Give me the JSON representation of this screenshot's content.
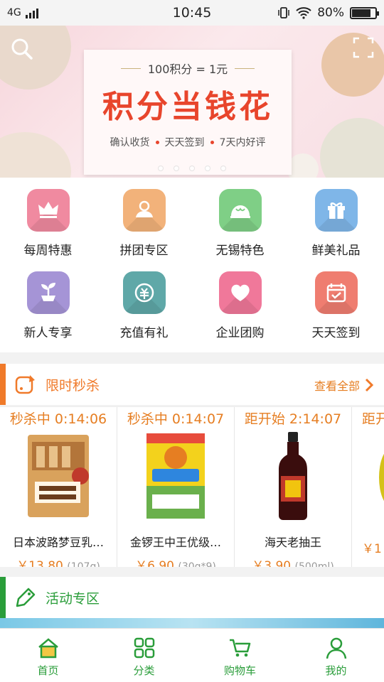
{
  "status_bar": {
    "network": "4G",
    "time": "10:45",
    "battery": "80%",
    "battery_level": 0.8
  },
  "banner": {
    "top_line": "100积分 = 1元",
    "title": "积分当钱花",
    "subs": [
      "确认收货",
      "天天签到",
      "7天内好评"
    ],
    "slides": 5,
    "active_slide": 3
  },
  "categories": [
    {
      "label": "每周特惠",
      "icon": "crown-icon",
      "color": "#f08aa0"
    },
    {
      "label": "拼团专区",
      "icon": "group-icon",
      "color": "#f2b27a"
    },
    {
      "label": "无锡特色",
      "icon": "bun-icon",
      "color": "#7fcf86"
    },
    {
      "label": "鲜美礼品",
      "icon": "gift-icon",
      "color": "#7fb6e8"
    },
    {
      "label": "新人专享",
      "icon": "sprout-icon",
      "color": "#a594d6"
    },
    {
      "label": "充值有礼",
      "icon": "coin-icon",
      "color": "#5fa8a8"
    },
    {
      "label": "企业团购",
      "icon": "heart-icon",
      "color": "#f0789a"
    },
    {
      "label": "天天签到",
      "icon": "calendar-check-icon",
      "color": "#ef7d70"
    }
  ],
  "flash_sale": {
    "title": "限时秒杀",
    "view_all": "查看全部",
    "accent": "#f07a2a",
    "products": [
      {
        "timer": "秒杀中 0:14:06",
        "name": "日本波路梦豆乳…",
        "price": "￥13.80",
        "unit": "(107g)"
      },
      {
        "timer": "秒杀中 0:14:07",
        "name": "金锣王中王优级…",
        "price": "￥6.90",
        "unit": "(30g*9)"
      },
      {
        "timer": "距开始 2:14:07",
        "name": "海天老抽王",
        "price": "￥3.90",
        "unit": "(500ml)"
      },
      {
        "timer": "距开",
        "name": "",
        "price": "￥1",
        "unit": ""
      }
    ]
  },
  "activity": {
    "title": "活动专区",
    "accent": "#2a9d3a"
  },
  "tabs": [
    {
      "label": "首页",
      "icon": "home-icon"
    },
    {
      "label": "分类",
      "icon": "grid-icon"
    },
    {
      "label": "购物车",
      "icon": "cart-icon"
    },
    {
      "label": "我的",
      "icon": "user-icon"
    }
  ]
}
